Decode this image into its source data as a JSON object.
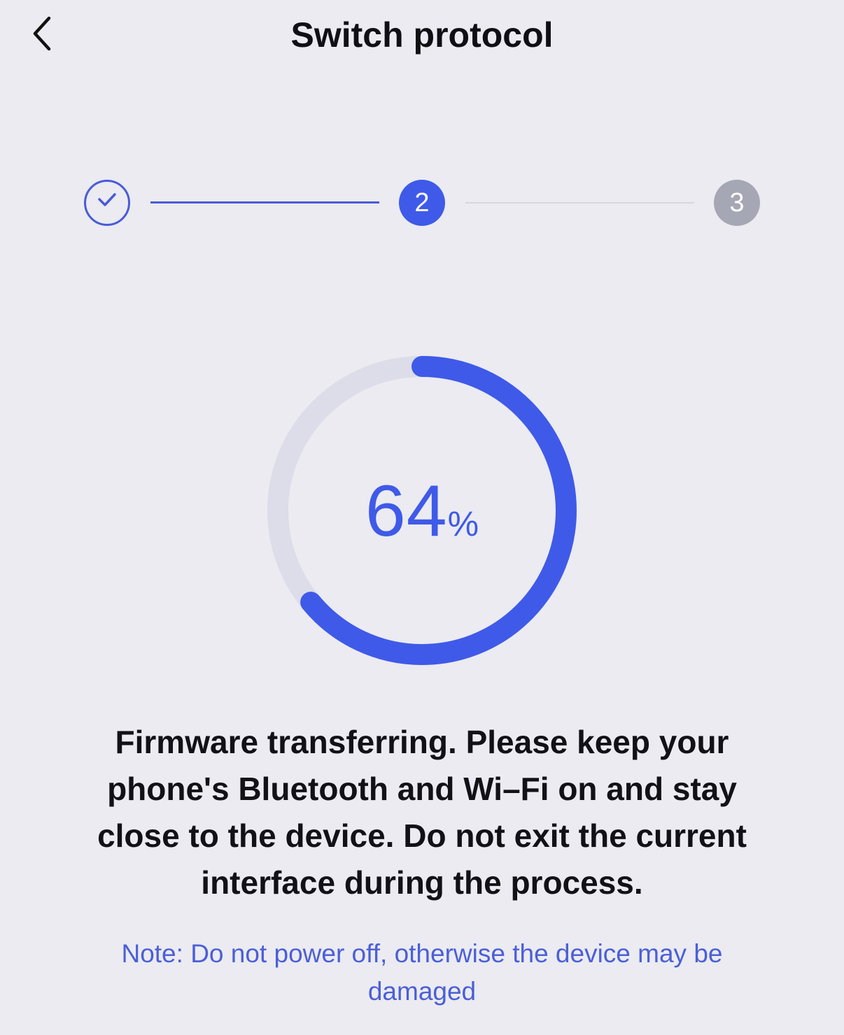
{
  "header": {
    "title": "Switch protocol",
    "back_icon": "chevron-left-icon"
  },
  "stepper": {
    "steps": [
      {
        "label": "",
        "state": "completed",
        "icon": "check-icon"
      },
      {
        "label": "2",
        "state": "active"
      },
      {
        "label": "3",
        "state": "pending"
      }
    ]
  },
  "progress": {
    "value": "64",
    "unit": "%",
    "fraction": 0.64
  },
  "message": "Firmware transferring. Please keep your phone's Bluetooth and Wi–Fi on and stay close to the device. Do not exit the current interface during the process.",
  "note": "Note: Do not power off, otherwise the device may be damaged",
  "colors": {
    "accent": "#3f5ae8",
    "track": "#dcdde8",
    "pending_step": "#a6a7b4",
    "background": "#ebebf1"
  }
}
